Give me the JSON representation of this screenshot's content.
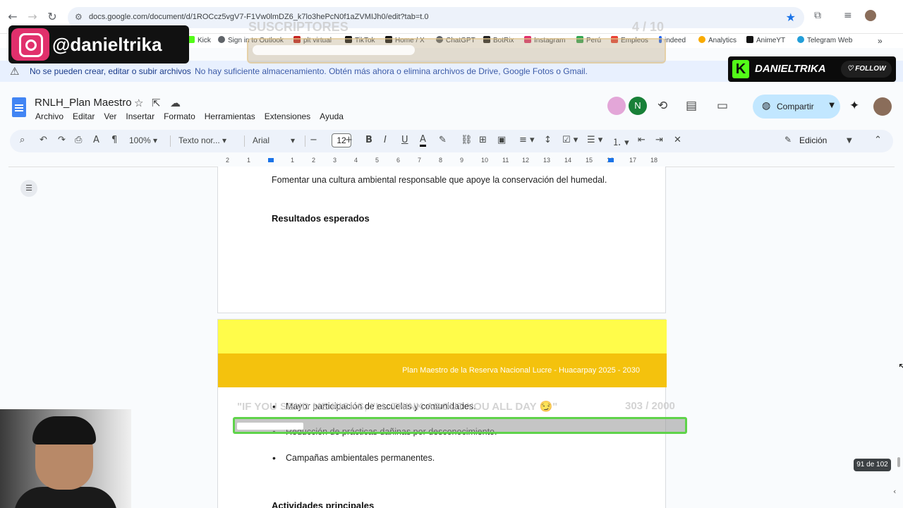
{
  "browser": {
    "url": "docs.google.com/document/d/1ROCcz5vgV7-F1Vw0lmDZ6_k7lo3hePcN0f1aZVMIJh0/edit?tab=t.0"
  },
  "bookmarks": [
    {
      "label": "Kick",
      "color": "#53fc18"
    },
    {
      "label": "Sign in to Outlook",
      "color": "#5f6368"
    },
    {
      "label": "plt virtual",
      "color": "#c5221f"
    },
    {
      "label": "TikTok",
      "color": "#111111"
    },
    {
      "label": "Home / X",
      "color": "#111111"
    },
    {
      "label": "ChatGPT",
      "color": "#5f6368"
    },
    {
      "label": "BotRix",
      "color": "#222222"
    },
    {
      "label": "Instagram",
      "color": "#e1306c"
    },
    {
      "label": "Perú",
      "color": "#34a853"
    },
    {
      "label": "Empleos",
      "color": "#ea4335"
    },
    {
      "label": "indeed",
      "color": "#2164f3"
    },
    {
      "label": "Analytics",
      "color": "#f9ab00"
    },
    {
      "label": "AnimeYT",
      "color": "#111111"
    },
    {
      "label": "Telegram Web",
      "color": "#229ed9"
    }
  ],
  "banner": {
    "title": "No se pueden crear, editar o subir archivos",
    "message": "No hay suficiente almacenamiento. Obtén más ahora o elimina archivos de Drive, Google Fotos o Gmail."
  },
  "docs": {
    "title": "RNLH_Plan Maestro",
    "menu": [
      "Archivo",
      "Editar",
      "Ver",
      "Insertar",
      "Formato",
      "Herramientas",
      "Extensiones",
      "Ayuda"
    ],
    "avatar_letter": "N",
    "share_label": "Compartir"
  },
  "toolbar": {
    "zoom": "100%",
    "style": "Texto nor...",
    "font": "Arial",
    "font_size": "12",
    "mode": "Edición"
  },
  "ruler": [
    "2",
    "1",
    "1",
    "2",
    "3",
    "4",
    "5",
    "6",
    "7",
    "8",
    "9",
    "10",
    "11",
    "12",
    "13",
    "14",
    "15",
    "16",
    "17",
    "18"
  ],
  "page1": {
    "paragraph": "Fomentar una cultura ambiental responsable que apoye la conservación del humedal.",
    "heading": "Resultados esperados"
  },
  "page2": {
    "header": "Plan Maestro de la Reserva Nacional Lucre - Huacarpay 2025 - 2030",
    "bullets": [
      "Mayor participación de escuelas y comunidades.",
      "Reducción de prácticas dañinas por desconocimiento.",
      "Campañas ambientales permanentes."
    ],
    "heading": "Actividades principales"
  },
  "page_count": "91 de 102",
  "overlays": {
    "instagram_handle": "@danieltrika",
    "subs_label": "SUSCRIPTORES",
    "subs_count": "4 / 10",
    "kick_name": "DANIELTRIKA",
    "kick_follow": "FOLLOW",
    "kicks_label": "\"IF YOU SEND ME KICKS, I'LL THINK ABOUT YOU ALL DAY 😏\"",
    "kicks_count": "303 / 2000"
  }
}
